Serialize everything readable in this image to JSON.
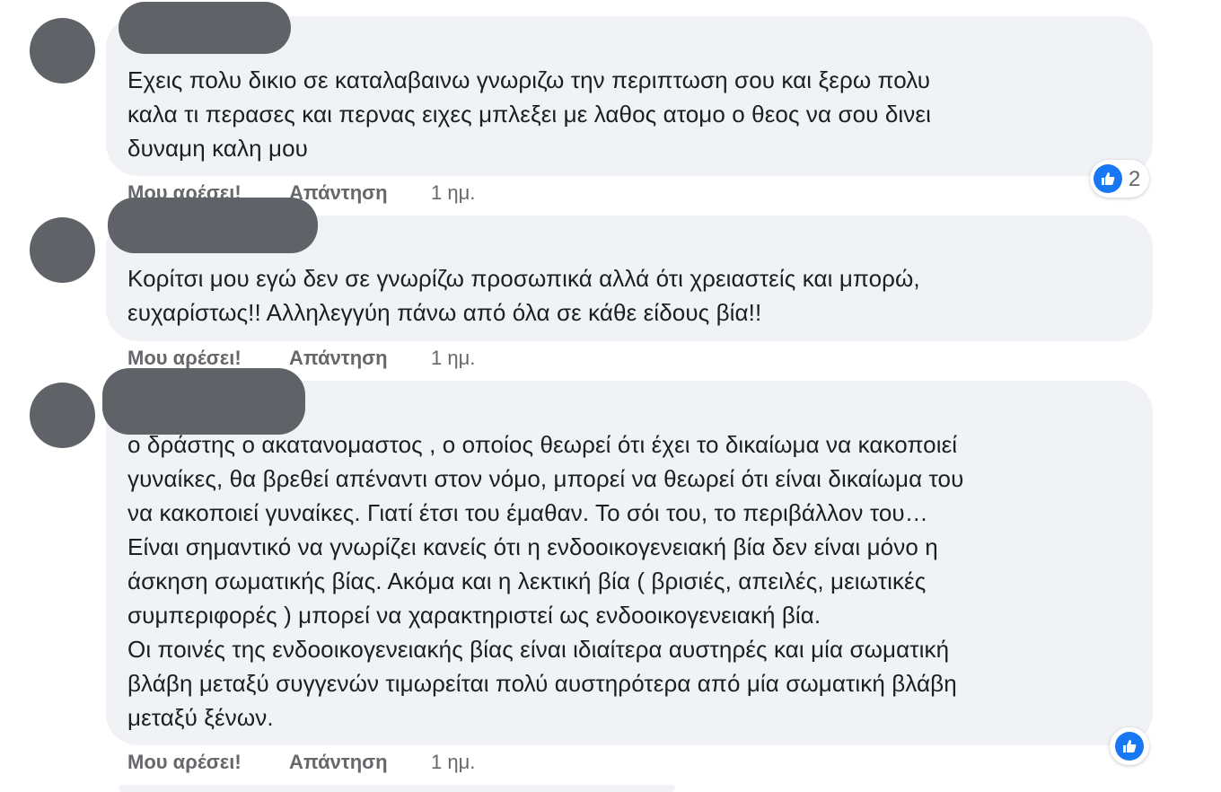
{
  "comments": [
    {
      "lines": [
        "Εχεις πολυ δικιο σε καταλαβαινω γνωριζω την περιπτωση σου και ξερω πολυ",
        "καλα τι περασες και περνας ειχες μπλεξει με λαθος ατομο ο θεος να σου δινει",
        "δυναμη καλη μου"
      ],
      "like_label": "Μου αρέσει!",
      "reply_label": "Απάντηση",
      "time": "1 ημ.",
      "reaction_count": "2"
    },
    {
      "lines": [
        "Κορίτσι μου εγώ δεν σε γνωρίζω προσωπικά αλλά ότι χρειαστείς και μπορώ,",
        "ευχαρίστως!! Αλληλεγγύη πάνω από όλα σε κάθε είδους βία!!"
      ],
      "like_label": "Μου αρέσει!",
      "reply_label": "Απάντηση",
      "time": "1 ημ."
    },
    {
      "lines": [
        "ο δράστης ο ακατανομαστος , ο οποίος θεωρεί ότι έχει το δικαίωμα να κακοποιεί",
        "γυναίκες, θα βρεθεί απέναντι στον νόμο, μπορεί να θεωρεί ότι είναι δικαίωμα του",
        "να κακοποιεί γυναίκες. Γιατί έτσι του έμαθαν. Το σόι του, το περιβάλλον του…",
        "Είναι σημαντικό να γνωρίζει κανείς ότι η ενδοοικογενειακή βία δεν είναι μόνο η",
        "άσκηση σωματικής βίας. Ακόμα και η λεκτική βία ( βρισιές, απειλές, μειωτικές",
        "συμπεριφορές ) μπορεί να χαρακτηριστεί ως ενδοοικογενειακή βία.",
        "Οι ποινές της ενδοοικογενειακής βίας είναι ιδιαίτερα αυστηρές και μία σωματική",
        "βλάβη μεταξύ συγγενών τιμωρείται πολύ αυστηρότερα από μία σωματική βλάβη",
        "μεταξύ ξένων."
      ],
      "like_label": "Μου αρέσει!",
      "reply_label": "Απάντηση",
      "time": "1 ημ."
    }
  ],
  "icons": {
    "like": "thumbs-up-icon",
    "avatar": "avatar-placeholder"
  },
  "colors": {
    "like_blue": "#1877f2",
    "bubble": "#f0f2f5",
    "redaction": "#5f6266",
    "meta_text": "#65676b"
  }
}
